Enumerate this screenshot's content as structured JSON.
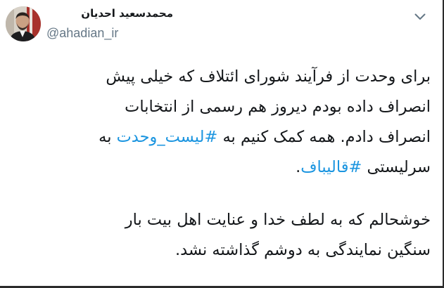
{
  "author": {
    "display_name": "محمدسعید احدیان",
    "handle": "@ahadian_ir"
  },
  "icons": {
    "menu": "chevron-down-icon",
    "avatar": "avatar-photo"
  },
  "colors": {
    "hashtag": "#1b95e0",
    "text": "#14171a",
    "handle": "#657786",
    "chevron": "#657786"
  },
  "tweet": {
    "line1": "برای وحدت از فرآیند شورای ائتلاف  که خیلی پیش",
    "line2": "انصراف داده بودم دیروز هم رسمی از انتخابات",
    "line3_text": "انصراف دادم. همه کمک کنیم به ",
    "hashtag_list": "#لیست_وحدت",
    "line3_tail": " به",
    "line4_text": "سرلیستی ",
    "hashtag_ghalibaf": "#قالیباف",
    "line4_tail": ".",
    "line5": "خوشحالم که به لطف خدا و عنایت اهل بیت بار",
    "line6": "سنگین نمایندگی به دوشم گذاشته نشد."
  }
}
